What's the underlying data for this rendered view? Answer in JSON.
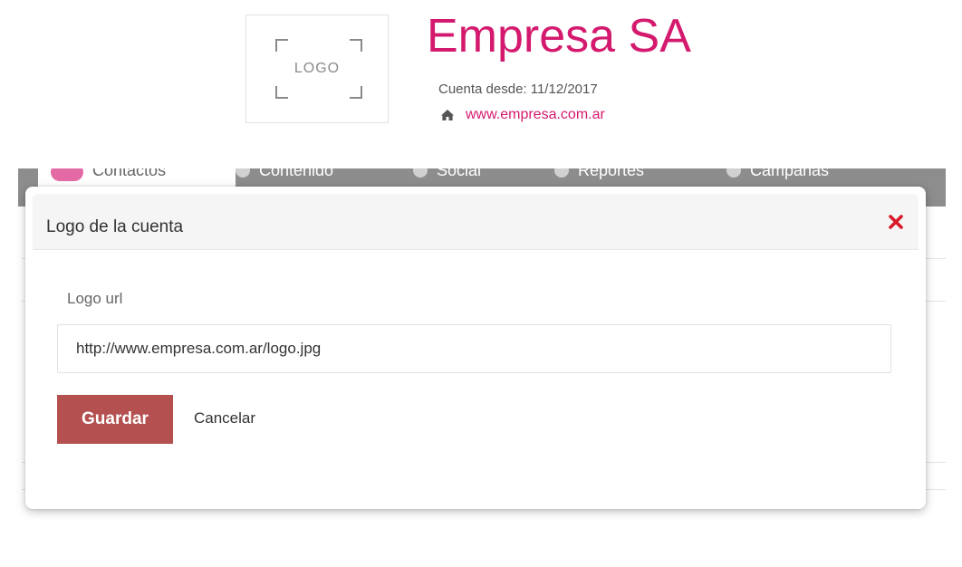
{
  "header": {
    "logo_placeholder": "LOGO",
    "company_name": "Empresa SA",
    "account_since": "Cuenta desde: 11/12/2017",
    "website": "www.empresa.com.ar"
  },
  "navbar": {
    "items": [
      {
        "label": "Contactos",
        "icon": "contacts-icon"
      },
      {
        "label": "Contenido",
        "icon": "document-icon"
      },
      {
        "label": "Social",
        "icon": "chat-icon"
      },
      {
        "label": "Reportes",
        "icon": "bar-chart-icon"
      },
      {
        "label": "Campañas",
        "icon": "campaign-icon"
      }
    ]
  },
  "modal": {
    "title": "Logo de la cuenta",
    "field_label": "Logo url",
    "url_value": "http://www.empresa.com.ar/logo.jpg",
    "save_label": "Guardar",
    "cancel_label": "Cancelar"
  },
  "colors": {
    "brand": "#d41a6e",
    "save_button": "#b55050",
    "close_icon": "#d8192a",
    "navbar": "#8d8d8d"
  }
}
